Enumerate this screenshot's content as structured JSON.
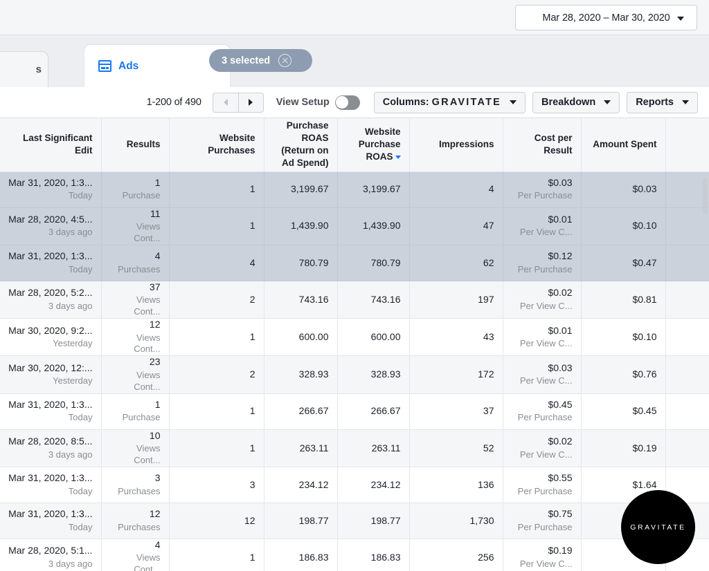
{
  "topbar": {
    "date_range": "Mar 28, 2020 – Mar 30, 2020",
    "caret_icon": "chevron-down-icon"
  },
  "tabs": {
    "partial_tab_label": "s",
    "active_tab_label": "Ads",
    "active_tab_icon": "ads-display-icon",
    "selection_pill_label": "3 selected",
    "selection_pill_close_icon": "close-circle-icon"
  },
  "toolbar": {
    "pagination": "1-200 of 490",
    "prev_icon": "triangle-left-icon",
    "next_icon": "triangle-right-icon",
    "view_setup_label": "View Setup",
    "view_setup_on": false,
    "columns_prefix": "Columns:",
    "columns_value": "GRAVITATE",
    "breakdown_label": "Breakdown",
    "reports_label": "Reports"
  },
  "table": {
    "columns": [
      {
        "label": "Last Significant Edit",
        "sorted": false
      },
      {
        "label": "Results",
        "sorted": false
      },
      {
        "label": "Website Purchases",
        "sorted": false
      },
      {
        "label": "Purchase ROAS (Return on Ad Spend)",
        "sorted": false
      },
      {
        "label": "Website Purchase ROAS",
        "sorted": true
      },
      {
        "label": "Impressions",
        "sorted": false
      },
      {
        "label": "Cost per Result",
        "sorted": false
      },
      {
        "label": "Amount Spent",
        "sorted": false
      },
      {
        "label": "",
        "sorted": false
      }
    ],
    "rows": [
      {
        "selected": true,
        "edit": "Mar 31, 2020, 1:3...",
        "edit_sub": "Today",
        "results": "1",
        "results_sub": "Purchase",
        "website_purchases": "1",
        "purchase_roas": "3,199.67",
        "website_purchase_roas": "3,199.67",
        "impressions": "4",
        "cost_per_result": "$0.03",
        "cost_per_result_sub": "Per Purchase",
        "amount_spent": "$0.03"
      },
      {
        "selected": true,
        "edit": "Mar 28, 2020, 4:5...",
        "edit_sub": "3 days ago",
        "results": "11",
        "results_sub": "Views Cont...",
        "website_purchases": "1",
        "purchase_roas": "1,439.90",
        "website_purchase_roas": "1,439.90",
        "impressions": "47",
        "cost_per_result": "$0.01",
        "cost_per_result_sub": "Per View C...",
        "amount_spent": "$0.10"
      },
      {
        "selected": true,
        "edit": "Mar 31, 2020, 1:3...",
        "edit_sub": "Today",
        "results": "4",
        "results_sub": "Purchases",
        "website_purchases": "4",
        "purchase_roas": "780.79",
        "website_purchase_roas": "780.79",
        "impressions": "62",
        "cost_per_result": "$0.12",
        "cost_per_result_sub": "Per Purchase",
        "amount_spent": "$0.47"
      },
      {
        "selected": false,
        "edit": "Mar 28, 2020, 5:2...",
        "edit_sub": "3 days ago",
        "results": "37",
        "results_sub": "Views Cont...",
        "website_purchases": "2",
        "purchase_roas": "743.16",
        "website_purchase_roas": "743.16",
        "impressions": "197",
        "cost_per_result": "$0.02",
        "cost_per_result_sub": "Per View C...",
        "amount_spent": "$0.81"
      },
      {
        "selected": false,
        "edit": "Mar 30, 2020, 9:2...",
        "edit_sub": "Yesterday",
        "results": "12",
        "results_sub": "Views Cont...",
        "website_purchases": "1",
        "purchase_roas": "600.00",
        "website_purchase_roas": "600.00",
        "impressions": "43",
        "cost_per_result": "$0.01",
        "cost_per_result_sub": "Per View C...",
        "amount_spent": "$0.10"
      },
      {
        "selected": false,
        "edit": "Mar 30, 2020, 12:...",
        "edit_sub": "Yesterday",
        "results": "23",
        "results_sub": "Views Cont...",
        "website_purchases": "2",
        "purchase_roas": "328.93",
        "website_purchase_roas": "328.93",
        "impressions": "172",
        "cost_per_result": "$0.03",
        "cost_per_result_sub": "Per View C...",
        "amount_spent": "$0.76"
      },
      {
        "selected": false,
        "edit": "Mar 31, 2020, 1:3...",
        "edit_sub": "Today",
        "results": "1",
        "results_sub": "Purchase",
        "website_purchases": "1",
        "purchase_roas": "266.67",
        "website_purchase_roas": "266.67",
        "impressions": "37",
        "cost_per_result": "$0.45",
        "cost_per_result_sub": "Per Purchase",
        "amount_spent": "$0.45"
      },
      {
        "selected": false,
        "edit": "Mar 28, 2020, 8:5...",
        "edit_sub": "3 days ago",
        "results": "10",
        "results_sub": "Views Cont...",
        "website_purchases": "1",
        "purchase_roas": "263.11",
        "website_purchase_roas": "263.11",
        "impressions": "52",
        "cost_per_result": "$0.02",
        "cost_per_result_sub": "Per View C...",
        "amount_spent": "$0.19"
      },
      {
        "selected": false,
        "edit": "Mar 31, 2020, 1:3...",
        "edit_sub": "Today",
        "results": "3",
        "results_sub": "Purchases",
        "website_purchases": "3",
        "purchase_roas": "234.12",
        "website_purchase_roas": "234.12",
        "impressions": "136",
        "cost_per_result": "$0.55",
        "cost_per_result_sub": "Per Purchase",
        "amount_spent": "$1.64"
      },
      {
        "selected": false,
        "edit": "Mar 31, 2020, 1:3...",
        "edit_sub": "Today",
        "results": "12",
        "results_sub": "Purchases",
        "website_purchases": "12",
        "purchase_roas": "198.77",
        "website_purchase_roas": "198.77",
        "impressions": "1,730",
        "cost_per_result": "$0.75",
        "cost_per_result_sub": "Per Purchase",
        "amount_spent": ""
      },
      {
        "selected": false,
        "edit": "Mar 28, 2020, 5:1...",
        "edit_sub": "3 days ago",
        "results": "4",
        "results_sub": "Views Cont...",
        "website_purchases": "1",
        "purchase_roas": "186.83",
        "website_purchase_roas": "186.83",
        "impressions": "256",
        "cost_per_result": "$0.19",
        "cost_per_result_sub": "Per View C...",
        "amount_spent": ""
      }
    ]
  },
  "watermark": {
    "text": "GRAVITATE"
  },
  "colors": {
    "accent": "#1877f2",
    "selected_row": "#cbd2dc",
    "pill": "#8d9cb0",
    "header_bg": "#f5f6f7"
  }
}
